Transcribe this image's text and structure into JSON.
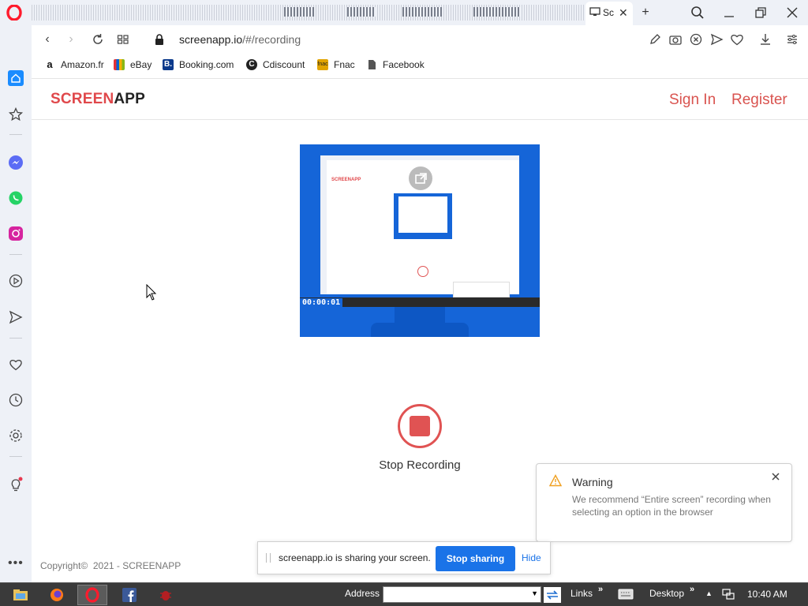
{
  "browser": {
    "tab": {
      "label": "Sc"
    },
    "url": {
      "host": "screenapp.io",
      "path": "/#/recording"
    }
  },
  "bookmarks": [
    {
      "label": "Amazon.fr",
      "icon": "amazon-icon",
      "color": "#111111"
    },
    {
      "label": "eBay",
      "icon": "ebay-icon",
      "color": "#e53238"
    },
    {
      "label": "Booking.com",
      "icon": "booking-icon",
      "color": "#0b3a8c"
    },
    {
      "label": "Cdiscount",
      "icon": "cdiscount-icon",
      "color": "#222222"
    },
    {
      "label": "Fnac",
      "icon": "fnac-icon",
      "color": "#e1a400"
    },
    {
      "label": "Facebook",
      "icon": "page-icon",
      "color": "#555555"
    }
  ],
  "site": {
    "logo": {
      "part1": "SCREEN",
      "part2": "APP"
    },
    "nav": {
      "sign_in": "Sign In",
      "register": "Register"
    },
    "accent_color": "#e0484b"
  },
  "preview": {
    "timer": "00:00:01"
  },
  "recording": {
    "stop_label": "Stop Recording"
  },
  "warning": {
    "title": "Warning",
    "message": "We recommend “Entire screen” recording when selecting an option in the browser"
  },
  "footer": {
    "copyright": "Copyright©  2021 - SCREENAPP"
  },
  "sharebar": {
    "text": "screenapp.io is sharing your screen.",
    "stop_button": "Stop sharing",
    "hide": "Hide"
  },
  "taskbar": {
    "address_label": "Address",
    "links_label": "Links",
    "desktop_label": "Desktop",
    "time": "10:40 AM"
  }
}
